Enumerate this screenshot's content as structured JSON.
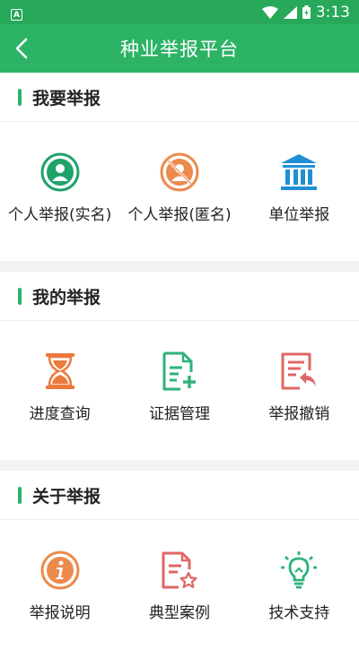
{
  "status": {
    "time": "3:13"
  },
  "app_bar": {
    "title": "种业举报平台"
  },
  "sections": [
    {
      "title": "我要举报",
      "items": [
        {
          "label": "个人举报(实名)",
          "icon": "person-circle-icon",
          "color": "#1ea36a"
        },
        {
          "label": "个人举报(匿名)",
          "icon": "anonymous-person-icon",
          "color": "#ec8a4c"
        },
        {
          "label": "单位举报",
          "icon": "bank-building-icon",
          "color": "#1f8fd4"
        }
      ]
    },
    {
      "title": "我的举报",
      "items": [
        {
          "label": "进度查询",
          "icon": "hourglass-icon",
          "color": "#ec7a3c"
        },
        {
          "label": "证据管理",
          "icon": "document-add-icon",
          "color": "#2eb37a"
        },
        {
          "label": "举报撤销",
          "icon": "document-undo-icon",
          "color": "#e06666"
        }
      ]
    },
    {
      "title": "关于举报",
      "items": [
        {
          "label": "举报说明",
          "icon": "info-circle-icon",
          "color": "#ec8a4c"
        },
        {
          "label": "典型案例",
          "icon": "document-star-icon",
          "color": "#e06666"
        },
        {
          "label": "技术支持",
          "icon": "lightbulb-icon",
          "color": "#2eb37a"
        }
      ]
    }
  ]
}
